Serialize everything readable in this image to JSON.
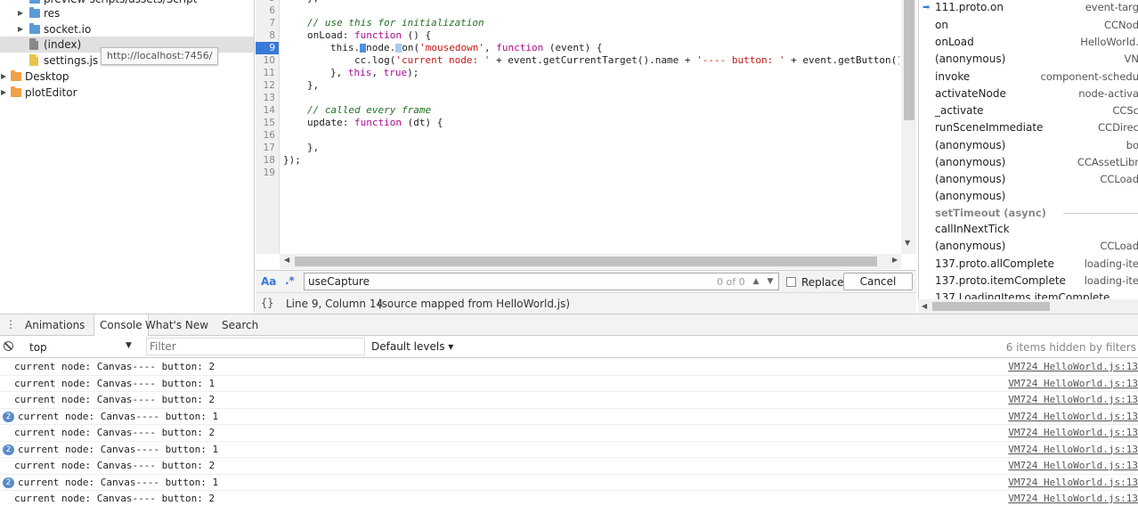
{
  "tree": {
    "items": [
      {
        "label": "preview-scripts/assets/Script",
        "kind": "folder",
        "has_arrow": false
      },
      {
        "label": "res",
        "kind": "folder",
        "has_arrow": true
      },
      {
        "label": "socket.io",
        "kind": "folder",
        "has_arrow": true
      },
      {
        "label": "(index)",
        "kind": "file",
        "has_arrow": false
      },
      {
        "label": "settings.js",
        "kind": "file",
        "has_arrow": false
      },
      {
        "label": "Desktop",
        "kind": "folder",
        "has_arrow": true
      },
      {
        "label": "plotEditor",
        "kind": "folder",
        "has_arrow": true
      }
    ],
    "tooltip": "http://localhost:7456/",
    "colors": {
      "folder_blue": "#5b9bd5",
      "folder_orange": "#f0a04b",
      "file_gray": "#888888",
      "file_yellow": "#e8c44a"
    }
  },
  "editor": {
    "line_numbers": [
      "6",
      "7",
      "8",
      "9",
      "10",
      "11",
      "12",
      "13",
      "14",
      "15",
      "16",
      "17",
      "18",
      "19"
    ],
    "active_line": "9",
    "top_partial": "},",
    "lines": {
      "l6": "",
      "l7_comment": "// use this for initialization",
      "l8_a": "onLoad: ",
      "l8_kw": "function",
      "l8_b": " () {",
      "l9_a": "this.",
      "l9_b": "node.",
      "l9_c": "on(",
      "l9_str": "'mousedown'",
      "l9_d": ", ",
      "l9_kw": "function",
      "l9_e": " (event) {",
      "l10_a": "cc.log(",
      "l10_str1": "'current node: '",
      "l10_b": " + event.getCurrentTarget().name + ",
      "l10_str2": "'---- button: '",
      "l10_c": " + event.getButton()",
      "l11_a": "}, ",
      "l11_kw1": "this",
      "l11_b": ", ",
      "l11_kw2": "true",
      "l11_c": ");",
      "l12": "},",
      "l14_comment": "// called every frame",
      "l15_a": "update: ",
      "l15_kw": "function",
      "l15_b": " (dt) {",
      "l17": "},",
      "l18": "});"
    }
  },
  "search": {
    "case_label": "Aa",
    "regex_label": ".*",
    "value": "useCapture",
    "match_count": "0 of 0",
    "replace_label": "Replace",
    "cancel_label": "Cancel"
  },
  "status": {
    "braces": "{}",
    "cursor": "Line 9, Column 14",
    "source_map": "(source mapped from HelloWorld.js)"
  },
  "callstack": {
    "frames_top": [
      {
        "fn": "111.proto.on",
        "loc": "event-targ"
      },
      {
        "fn": "on",
        "loc": "CCNod"
      },
      {
        "fn": "onLoad",
        "loc": "HelloWorld."
      },
      {
        "fn": "(anonymous)",
        "loc": "VN"
      },
      {
        "fn": "invoke",
        "loc": "component-schedu"
      },
      {
        "fn": "activateNode",
        "loc": "node-activa"
      },
      {
        "fn": "_activate",
        "loc": "CCSc"
      },
      {
        "fn": "runSceneImmediate",
        "loc": "CCDirec"
      },
      {
        "fn": "(anonymous)",
        "loc": "bo"
      },
      {
        "fn": "(anonymous)",
        "loc": "CCAssetLibr"
      },
      {
        "fn": "(anonymous)",
        "loc": "CCLoad"
      },
      {
        "fn": "(anonymous)",
        "loc": ""
      }
    ],
    "async_label": "setTimeout (async)",
    "frames_bottom": [
      {
        "fn": "callInNextTick",
        "loc": ""
      },
      {
        "fn": "(anonymous)",
        "loc": "CCLoad"
      },
      {
        "fn": "137.proto.allComplete",
        "loc": "loading-ite"
      },
      {
        "fn": "137.proto.itemComplete",
        "loc": "loading-ite"
      },
      {
        "fn": "137.LoadingItems.itemComplete",
        "loc": ""
      }
    ]
  },
  "drawer": {
    "menu": "⋮",
    "tabs": [
      "Animations",
      "Console",
      "What's New",
      "Search"
    ],
    "active_tab": "Console"
  },
  "console": {
    "context": "top",
    "filter_placeholder": "Filter",
    "levels": "Default levels ▾",
    "hidden": "6 items hidden by filters",
    "messages": [
      {
        "count": "",
        "text": "current node: Canvas---- button: 2",
        "src": "VM724 HelloWorld.js:13"
      },
      {
        "count": "",
        "text": "current node: Canvas---- button: 1",
        "src": "VM724 HelloWorld.js:13"
      },
      {
        "count": "",
        "text": "current node: Canvas---- button: 2",
        "src": "VM724 HelloWorld.js:13"
      },
      {
        "count": "2",
        "text": "current node: Canvas---- button: 1",
        "src": "VM724 HelloWorld.js:13"
      },
      {
        "count": "",
        "text": "current node: Canvas---- button: 2",
        "src": "VM724 HelloWorld.js:13"
      },
      {
        "count": "2",
        "text": "current node: Canvas---- button: 1",
        "src": "VM724 HelloWorld.js:13"
      },
      {
        "count": "",
        "text": "current node: Canvas---- button: 2",
        "src": "VM724 HelloWorld.js:13"
      },
      {
        "count": "2",
        "text": "current node: Canvas---- button: 1",
        "src": "VM724 HelloWorld.js:13"
      },
      {
        "count": "",
        "text": "current node: Canvas---- button: 2",
        "src": "VM724 HelloWorld.js:13"
      }
    ]
  }
}
